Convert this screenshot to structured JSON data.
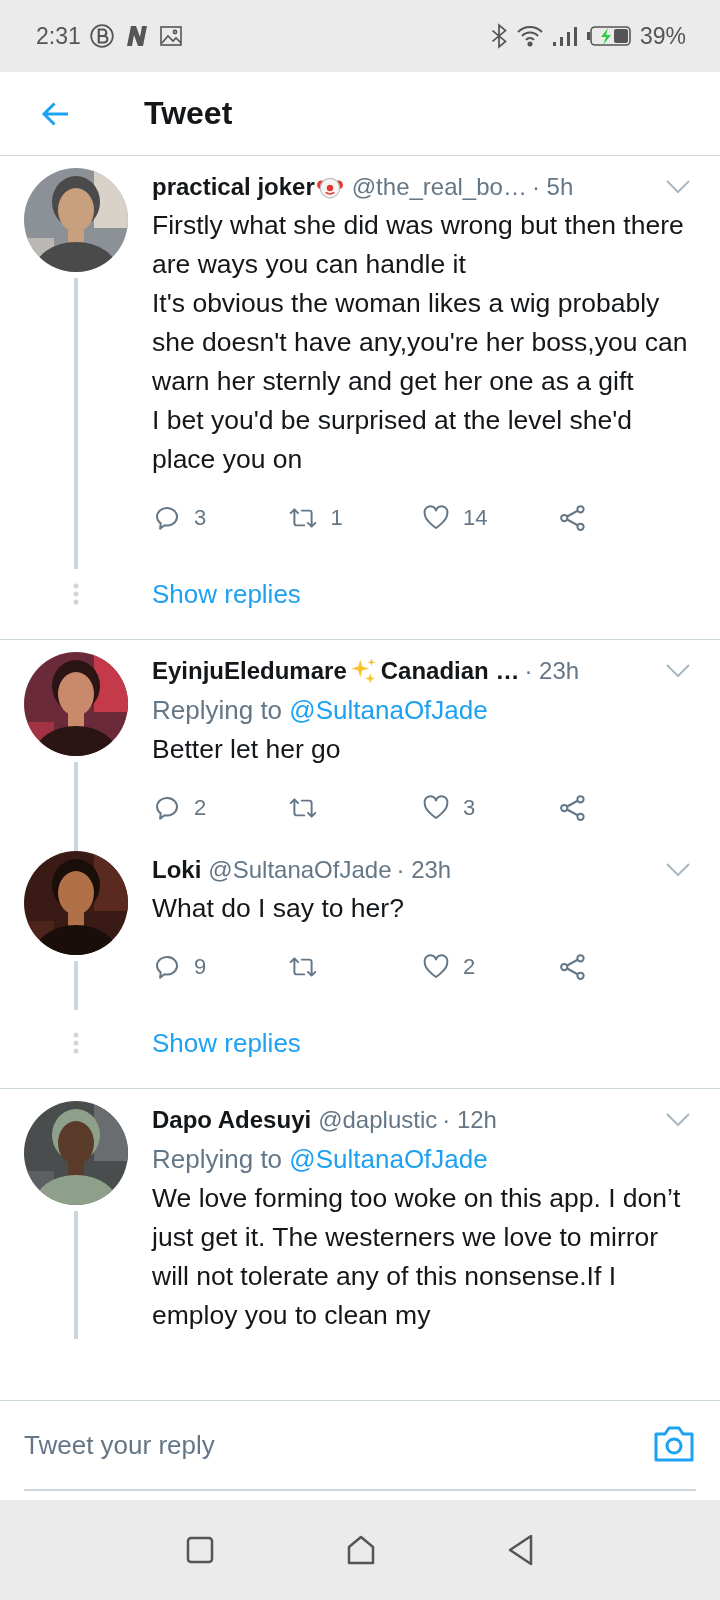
{
  "status_bar": {
    "time": "2:31",
    "battery": "39%"
  },
  "header": {
    "title": "Tweet"
  },
  "groups": [
    {
      "tweets": [
        {
          "name": "practical joker",
          "badge": {
            "kind": "clown"
          },
          "handle": "@the_real_bo…",
          "time": "· 5h",
          "text": "Firstly what she did was wrong but then there are ways you can handle it\nIt's obvious the woman likes a wig probably she doesn't have any,you're her boss,you can warn her sternly and get her one as a gift\nI bet you'd be surprised at the level she'd place you on",
          "actions": [
            {
              "kind": "reply",
              "count": "3"
            },
            {
              "kind": "retweet",
              "count": "1"
            },
            {
              "kind": "like",
              "count": "14"
            },
            {
              "kind": "share"
            }
          ]
        }
      ],
      "show_replies": "Show replies"
    },
    {
      "tweets": [
        {
          "name": "EyinjuEledumare",
          "badge": {
            "kind": "sparkles"
          },
          "name_rest": "Canadian …",
          "time": "· 23h",
          "replying_to": "Replying to",
          "mention": "@SultanaOfJade",
          "text": "Better let her go",
          "actions": [
            {
              "kind": "reply",
              "count": "2"
            },
            {
              "kind": "retweet"
            },
            {
              "kind": "like",
              "count": "3"
            },
            {
              "kind": "share"
            }
          ]
        },
        {
          "name": "Loki",
          "handle": "@SultanaOfJade",
          "time": "· 23h",
          "text": "What do I say to her?",
          "actions": [
            {
              "kind": "reply",
              "count": "9"
            },
            {
              "kind": "retweet"
            },
            {
              "kind": "like",
              "count": "2"
            },
            {
              "kind": "share"
            }
          ]
        }
      ],
      "show_replies": "Show replies"
    },
    {
      "tweets": [
        {
          "name": "Dapo Adesuyi",
          "handle": "@daplustic",
          "time": "· 12h",
          "replying_to": "Replying to",
          "mention": "@SultanaOfJade",
          "text": "We love forming too woke on this app. I don’t just get it. The westerners we love to mirror will not tolerate any of this nonsense.If I employ you to clean my"
        }
      ]
    }
  ],
  "reply_bar": {
    "placeholder": "Tweet your reply"
  }
}
